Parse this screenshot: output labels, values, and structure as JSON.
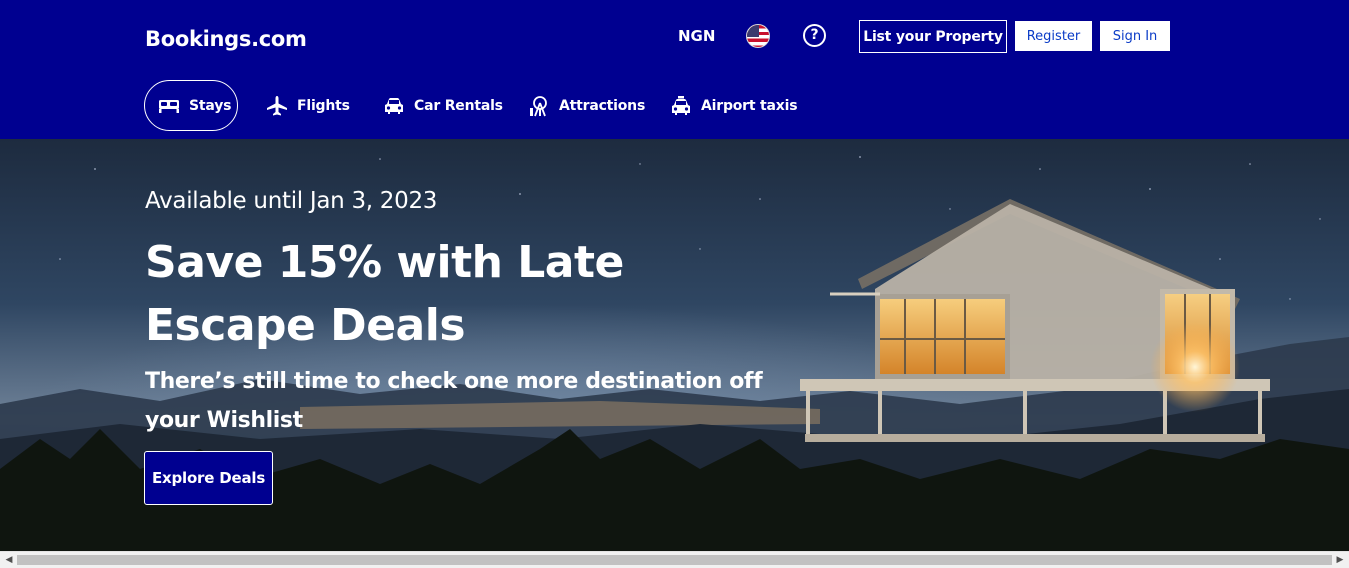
{
  "header": {
    "brand": "Bookings.com",
    "currency": "NGN",
    "language_flag": "us-flag-icon",
    "help_icon": "?",
    "list_property": "List your Property",
    "register": "Register",
    "sign_in": "Sign In"
  },
  "nav": {
    "items": [
      {
        "label": "Stays",
        "icon": "bed-icon",
        "active": true
      },
      {
        "label": "Flights",
        "icon": "airplane-icon"
      },
      {
        "label": "Car Rentals",
        "icon": "car-icon"
      },
      {
        "label": "Attractions",
        "icon": "ferris-wheel-icon"
      },
      {
        "label": "Airport taxis",
        "icon": "taxi-icon"
      }
    ]
  },
  "hero": {
    "availability": "Available until Jan 3, 2023",
    "title": "Save 15% with Late Escape Deals",
    "subtitle": "There’s still time to check one more destination off your Wishlist",
    "cta": "Explore Deals"
  },
  "colors": {
    "header_bg": "#000090",
    "cta_bg": "#000090",
    "accent_link": "#0b3cc7"
  }
}
